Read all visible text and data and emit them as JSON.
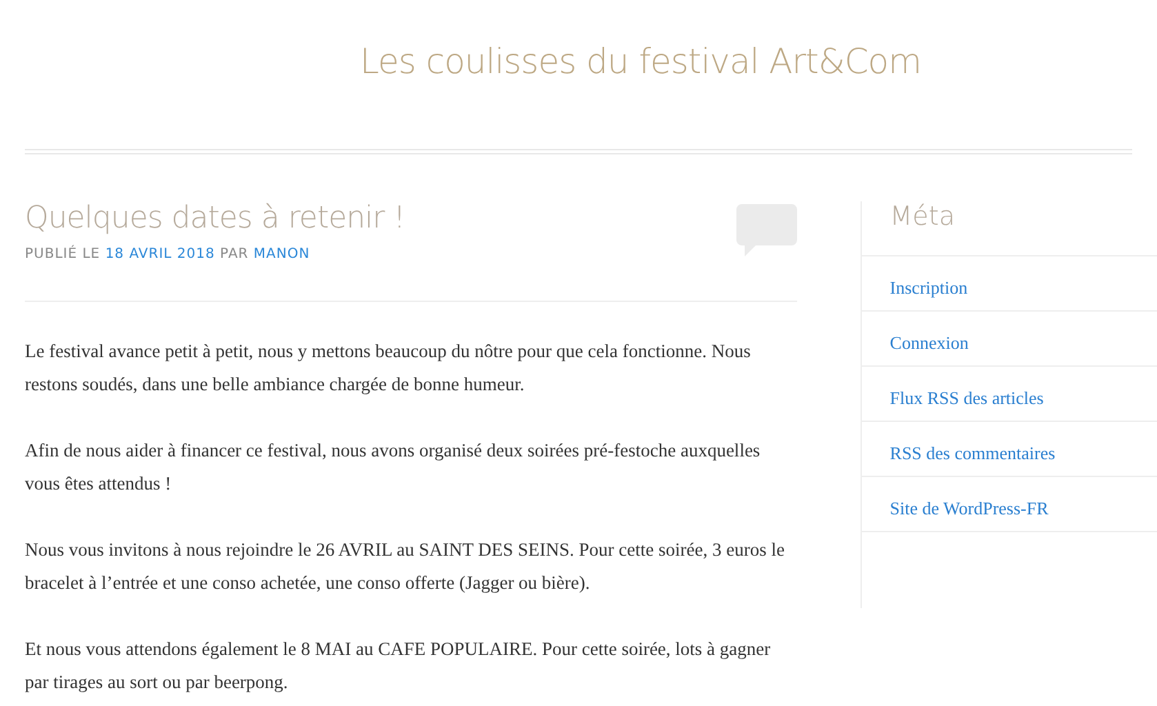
{
  "site": {
    "title": "Les coulisses du festival Art&Com"
  },
  "post": {
    "title": "Quelques dates à retenir !",
    "meta": [
      {
        "kind": "text",
        "text": "PUBLIÉ LE"
      },
      {
        "kind": "link",
        "text": "18 AVRIL 2018"
      },
      {
        "kind": "text",
        "text": "PAR"
      },
      {
        "kind": "link",
        "text": "MANON"
      }
    ],
    "paragraphs": [
      "Le festival avance petit à petit, nous y mettons beaucoup du nôtre pour que cela fonctionne. Nous restons soudés, dans une belle ambiance chargée de bonne humeur.",
      "Afin de nous aider à financer ce festival, nous avons organisé deux soirées pré-festoche auxquelles vous êtes attendus !",
      "Nous vous invitons à nous rejoindre le 26 AVRIL au SAINT DES SEINS. Pour cette soirée, 3 euros le bracelet à l’entrée et une conso achetée, une conso offerte (Jagger ou bière).",
      "Et nous vous attendons également le 8 MAI au CAFE POPULAIRE. Pour cette soirée, lots à gagner par tirages au sort ou par beerpong."
    ]
  },
  "sidebar": {
    "title": "Méta",
    "links": [
      "Inscription",
      "Connexion",
      "Flux RSS des articles",
      "RSS des commentaires",
      "Site de WordPress-FR"
    ]
  }
}
